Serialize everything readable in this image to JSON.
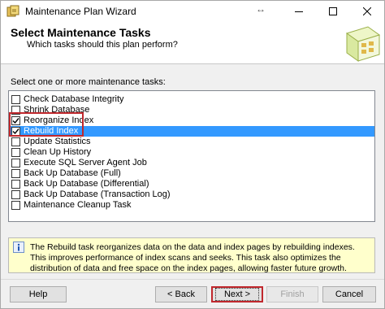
{
  "window": {
    "title": "Maintenance Plan Wizard",
    "resize_glyph": "↔",
    "icons": [
      "app-icon",
      "minimize-icon",
      "maximize-icon",
      "close-icon"
    ]
  },
  "header": {
    "title": "Select Maintenance Tasks",
    "subtitle": "Which tasks should this plan perform?"
  },
  "prompt": "Select one or more maintenance tasks:",
  "tasks": [
    {
      "label": "Check Database Integrity",
      "checked": false,
      "selected": false
    },
    {
      "label": "Shrink Database",
      "checked": false,
      "selected": false
    },
    {
      "label": "Reorganize Index",
      "checked": true,
      "selected": false
    },
    {
      "label": "Rebuild Index",
      "checked": true,
      "selected": true
    },
    {
      "label": "Update Statistics",
      "checked": false,
      "selected": false
    },
    {
      "label": "Clean Up History",
      "checked": false,
      "selected": false
    },
    {
      "label": "Execute SQL Server Agent Job",
      "checked": false,
      "selected": false
    },
    {
      "label": "Back Up Database (Full)",
      "checked": false,
      "selected": false
    },
    {
      "label": "Back Up Database (Differential)",
      "checked": false,
      "selected": false
    },
    {
      "label": "Back Up Database (Transaction Log)",
      "checked": false,
      "selected": false
    },
    {
      "label": "Maintenance Cleanup Task",
      "checked": false,
      "selected": false
    }
  ],
  "description": "The Rebuild task reorganizes data on the data and index pages by rebuilding indexes. This improves performance of index scans and seeks. This task also optimizes the distribution of data and free space on the index pages, allowing faster future growth.",
  "buttons": {
    "help": "Help",
    "back": "< Back",
    "next": "Next >",
    "finish": "Finish",
    "cancel": "Cancel"
  },
  "colors": {
    "selection": "#3399ff",
    "highlight_box": "#c0282d",
    "description_bg": "#ffffcc"
  }
}
